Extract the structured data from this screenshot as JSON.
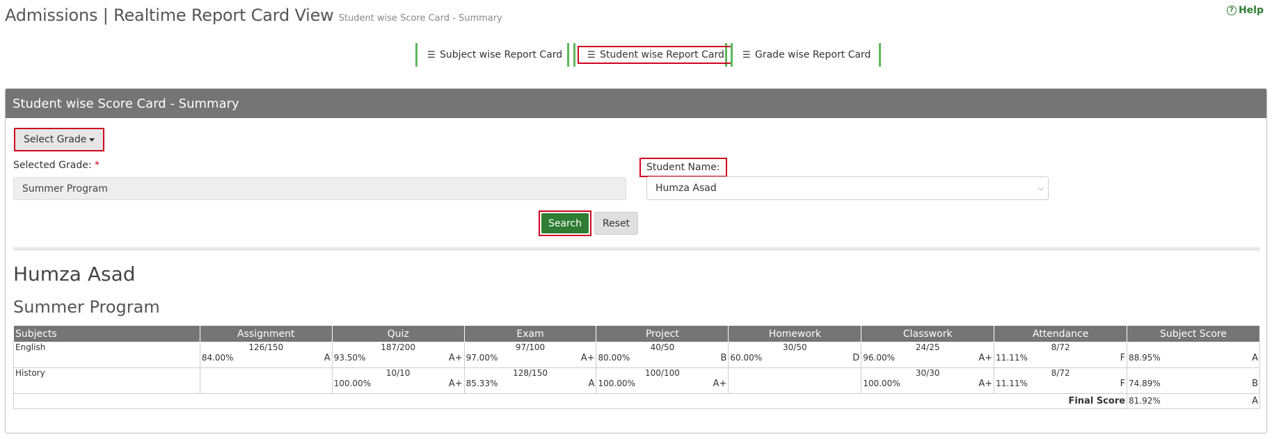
{
  "header": {
    "title": "Admissions | Realtime Report Card View",
    "subtitle": "Student wise Score Card - Summary",
    "help": "Help"
  },
  "tabs": [
    {
      "label": "Subject wise Report Card"
    },
    {
      "label": "Student wise Report Card"
    },
    {
      "label": "Grade wise Report Card"
    }
  ],
  "panel": {
    "heading": "Student wise Score Card - Summary",
    "select_grade": "Select Grade",
    "selected_grade_label": "Selected Grade:",
    "required_mark": "*",
    "selected_grade_value": "Summer Program",
    "student_name_label": "Student Name:",
    "student_name_value": "Humza Asad",
    "search": "Search",
    "reset": "Reset"
  },
  "report": {
    "student": "Humza Asad",
    "program": "Summer Program",
    "columns": [
      "Subjects",
      "Assignment",
      "Quiz",
      "Exam",
      "Project",
      "Homework",
      "Classwork",
      "Attendance",
      "Subject Score"
    ],
    "rows": [
      {
        "subject": "English",
        "cells": [
          {
            "score": "126/150",
            "pct": "84.00%",
            "grade": "A"
          },
          {
            "score": "187/200",
            "pct": "93.50%",
            "grade": "A+"
          },
          {
            "score": "97/100",
            "pct": "97.00%",
            "grade": "A+"
          },
          {
            "score": "40/50",
            "pct": "80.00%",
            "grade": "B"
          },
          {
            "score": "30/50",
            "pct": "60.00%",
            "grade": "D"
          },
          {
            "score": "24/25",
            "pct": "96.00%",
            "grade": "A+"
          },
          {
            "score": "8/72",
            "pct": "11.11%",
            "grade": "F"
          },
          {
            "score": "",
            "pct": "88.95%",
            "grade": "A"
          }
        ]
      },
      {
        "subject": "History",
        "cells": [
          {
            "score": "",
            "pct": "",
            "grade": ""
          },
          {
            "score": "10/10",
            "pct": "100.00%",
            "grade": "A+"
          },
          {
            "score": "128/150",
            "pct": "85.33%",
            "grade": "A"
          },
          {
            "score": "100/100",
            "pct": "100.00%",
            "grade": "A+"
          },
          {
            "score": "",
            "pct": "",
            "grade": ""
          },
          {
            "score": "30/30",
            "pct": "100.00%",
            "grade": "A+"
          },
          {
            "score": "8/72",
            "pct": "11.11%",
            "grade": "F"
          },
          {
            "score": "",
            "pct": "74.89%",
            "grade": "B"
          }
        ]
      }
    ],
    "final_label": "Final Score",
    "final_pct": "81.92%",
    "final_grade": "A"
  },
  "icons": {
    "help": "question-circle-icon",
    "tab": "list-icon",
    "select": "chevron-down-icon"
  },
  "colors": {
    "accent_green": "#2e7d32",
    "tab_border": "#5cb85c",
    "panel_heading": "#757575",
    "highlight_red": "#d0021b"
  }
}
